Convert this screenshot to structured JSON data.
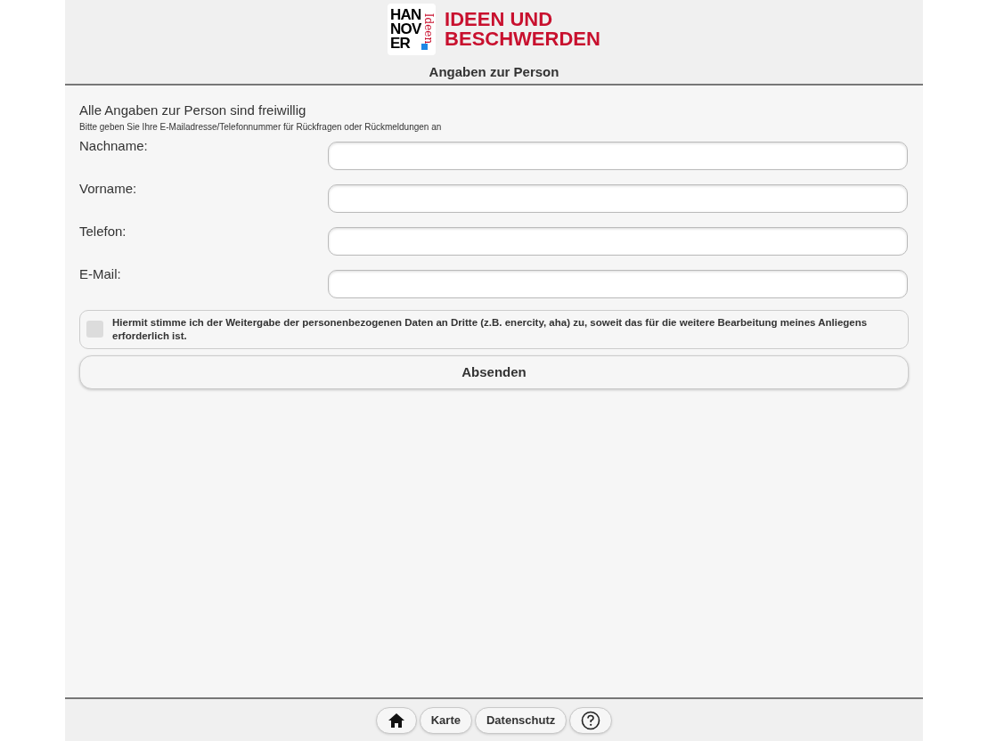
{
  "logo": {
    "lines": [
      "HAN",
      "NOV",
      "ER"
    ],
    "vertical": "Ideen"
  },
  "brand": [
    "IDEEN UND",
    "BESCHWERDEN"
  ],
  "page_title": "Angaben zur Person",
  "intro": "Alle Angaben zur Person sind freiwillig",
  "hint": "Bitte geben Sie Ihre E-Mailadresse/Telefonnummer für Rückfragen oder Rückmeldungen an",
  "fields": [
    {
      "label": "Nachname:"
    },
    {
      "label": "Vorname:"
    },
    {
      "label": "Telefon:"
    },
    {
      "label": "E-Mail:"
    }
  ],
  "consent": {
    "checked": false,
    "text": "Hiermit stimme ich der Weitergabe der personenbezogenen Daten an Dritte (z.B. enercity, aha) zu, soweit das für die weitere Bearbeitung meines Anliegens erforderlich ist."
  },
  "submit": "Absenden",
  "footer": [
    {
      "kind": "home"
    },
    {
      "kind": "text",
      "label": "Karte"
    },
    {
      "kind": "text",
      "label": "Datenschutz"
    },
    {
      "kind": "help"
    }
  ]
}
